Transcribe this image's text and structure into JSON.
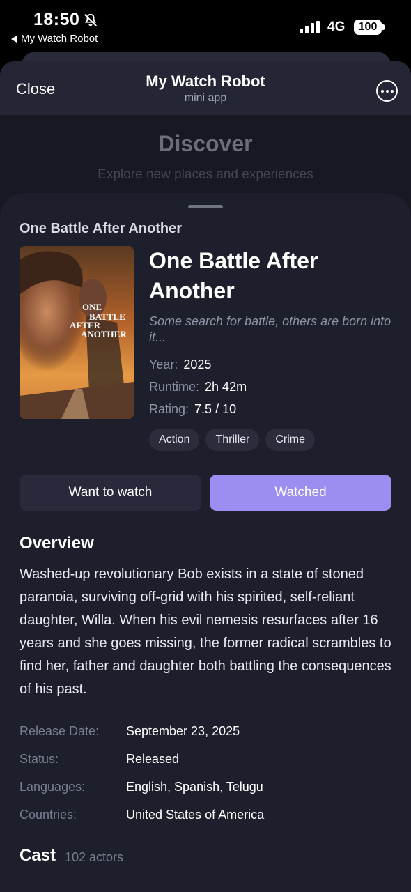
{
  "status_bar": {
    "time": "18:50",
    "back_app": "My Watch Robot",
    "network": "4G",
    "battery": "100"
  },
  "header": {
    "close_label": "Close",
    "title": "My Watch Robot",
    "subtitle": "mini app"
  },
  "background_page": {
    "title": "Discover",
    "subtitle": "Explore new places and experiences"
  },
  "movie": {
    "sheet_heading": "One Battle After Another",
    "title": "One Battle After Another",
    "tagline": "Some search for battle, others are born into it...",
    "poster_text": [
      "ONE",
      "BATTLE",
      "AFTER",
      "ANOTHER"
    ],
    "meta": [
      {
        "label": "Year:",
        "value": "2025"
      },
      {
        "label": "Runtime:",
        "value": "2h 42m"
      },
      {
        "label": "Rating:",
        "value": "7.5 / 10"
      }
    ],
    "genres": [
      "Action",
      "Thriller",
      "Crime"
    ]
  },
  "actions": {
    "want_to_watch": "Want to watch",
    "watched": "Watched"
  },
  "overview": {
    "heading": "Overview",
    "text": "Washed-up revolutionary Bob exists in a state of stoned paranoia, surviving off-grid with his spirited, self-reliant daughter, Willa. When his evil nemesis resurfaces after 16 years and she goes missing, the former radical scrambles to find her, father and daughter both battling the consequences of his past."
  },
  "details": [
    {
      "label": "Release Date:",
      "value": "September 23, 2025"
    },
    {
      "label": "Status:",
      "value": "Released"
    },
    {
      "label": "Languages:",
      "value": "English, Spanish, Telugu"
    },
    {
      "label": "Countries:",
      "value": "United States of America"
    }
  ],
  "cast": {
    "heading": "Cast",
    "count": "102 actors"
  },
  "colors": {
    "accent": "#9b8ef0",
    "sheet_bg": "#1d1f2c",
    "chip_bg": "#2b2d3d"
  }
}
